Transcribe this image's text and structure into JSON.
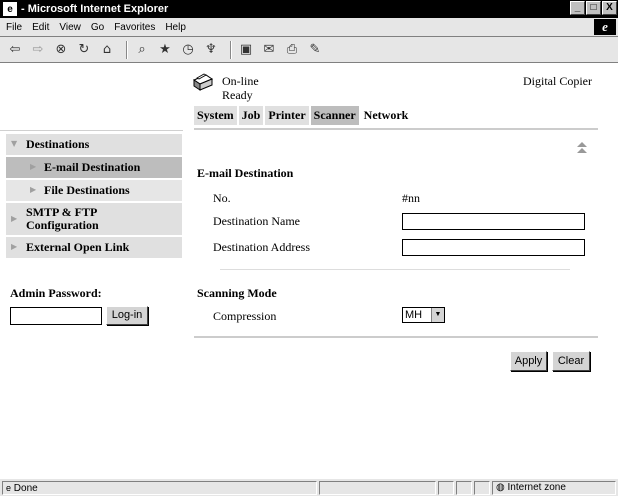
{
  "window": {
    "title": " - Microsoft Internet Explorer",
    "minimize": "_",
    "maximize": "□",
    "close": "X"
  },
  "menu": [
    "File",
    "Edit",
    "View",
    "Go",
    "Favorites",
    "Help"
  ],
  "toolbar_icons": [
    "back-icon",
    "forward-icon",
    "stop-icon",
    "refresh-icon",
    "home-icon",
    "search-icon",
    "favorites-icon",
    "history-icon",
    "channels-icon",
    "fullscreen-icon",
    "mail-icon",
    "print-icon",
    "edit-icon"
  ],
  "header": {
    "status_line1": "On-line",
    "status_line2": "Ready",
    "device": "Digital Copier"
  },
  "tabs": [
    {
      "label": "System",
      "active": false
    },
    {
      "label": "Job",
      "active": false
    },
    {
      "label": "Printer",
      "active": false
    },
    {
      "label": "Scanner",
      "active": true
    },
    {
      "label": "Network",
      "active": false
    }
  ],
  "sidebar": {
    "items": [
      {
        "label": "Destinations"
      },
      {
        "label": "E-mail Destination"
      },
      {
        "label": "File Destinations"
      },
      {
        "label": "SMTP & FTP Configuration"
      },
      {
        "label": "External Open Link"
      }
    ],
    "admin_label": "Admin Password:",
    "login_label": "Log-in"
  },
  "form": {
    "section1_title": "E-mail Destination",
    "no_label": "No.",
    "no_value": "#nn",
    "dest_name_label": "Destination Name",
    "dest_address_label": "Destination Address",
    "section2_title": "Scanning Mode",
    "compression_label": "Compression",
    "compression_value": "MH",
    "apply_label": "Apply",
    "clear_label": "Clear"
  },
  "statusbar": {
    "left": "Done",
    "zone": "Internet zone"
  },
  "colors": {
    "active_tab": "#bdbdbd",
    "nav_bg": "#e0e0e0",
    "chrome": "#e6e6e6"
  }
}
